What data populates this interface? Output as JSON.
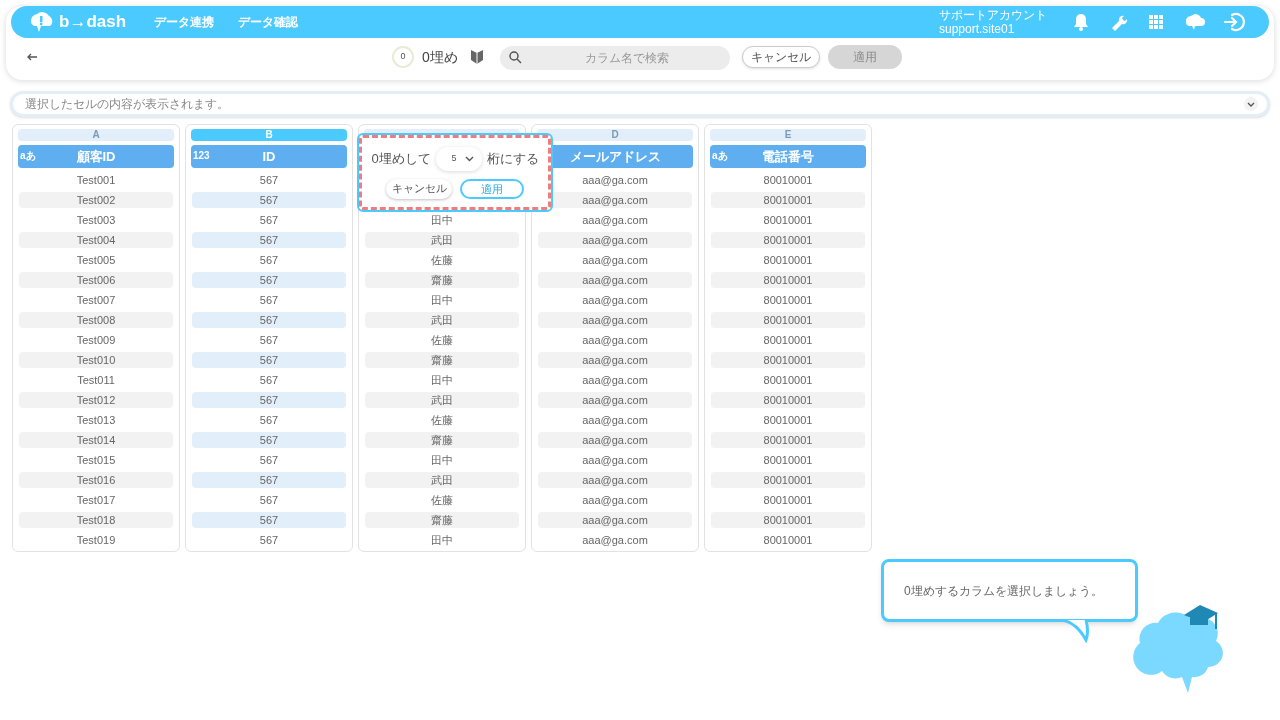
{
  "header": {
    "logo": "b→dash",
    "nav": [
      "データ連携",
      "データ確認"
    ],
    "account": {
      "name": "サポートアカウント",
      "id": "support.site01"
    }
  },
  "toolbar": {
    "feature_badge": "0",
    "feature_title": "0埋め",
    "search": {
      "placeholder": "カラム名で検索"
    },
    "cancel": "キャンセル",
    "apply": {
      "label": "適用",
      "disabled": true
    }
  },
  "cell_preview": {
    "placeholder": "選択したセルの内容が表示されます。"
  },
  "columns": [
    {
      "letter": "A",
      "title": "顧客ID",
      "type_label": "aあ",
      "selected": false,
      "cells": [
        "Test001",
        "Test002",
        "Test003",
        "Test004",
        "Test005",
        "Test006",
        "Test007",
        "Test008",
        "Test009",
        "Test010",
        "Test011",
        "Test012",
        "Test013",
        "Test014",
        "Test015",
        "Test016",
        "Test017",
        "Test018",
        "Test019"
      ]
    },
    {
      "letter": "B",
      "title": "ID",
      "type_label": "123",
      "selected": true,
      "cells": [
        "567",
        "567",
        "567",
        "567",
        "567",
        "567",
        "567",
        "567",
        "567",
        "567",
        "567",
        "567",
        "567",
        "567",
        "567",
        "567",
        "567",
        "567",
        "567"
      ]
    },
    {
      "selected": false,
      "cells": [
        "田中",
        "武田",
        "佐藤",
        "齋藤",
        "田中",
        "武田",
        "佐藤",
        "齋藤",
        "田中",
        "武田",
        "佐藤",
        "齋藤",
        "田中",
        "武田",
        "佐藤",
        "齋藤",
        "田中"
      ]
    },
    {
      "letter": "D",
      "title": "メールアドレス",
      "selected": false,
      "cells": [
        "aaa@ga.com",
        "aaa@ga.com",
        "aaa@ga.com",
        "aaa@ga.com",
        "aaa@ga.com",
        "aaa@ga.com",
        "aaa@ga.com",
        "aaa@ga.com",
        "aaa@ga.com",
        "aaa@ga.com",
        "aaa@ga.com",
        "aaa@ga.com",
        "aaa@ga.com",
        "aaa@ga.com",
        "aaa@ga.com",
        "aaa@ga.com",
        "aaa@ga.com",
        "aaa@ga.com",
        "aaa@ga.com"
      ]
    },
    {
      "letter": "E",
      "title": "電話番号",
      "type_label": "aあ",
      "selected": false,
      "cells": [
        "80010001",
        "80010001",
        "80010001",
        "80010001",
        "80010001",
        "80010001",
        "80010001",
        "80010001",
        "80010001",
        "80010001",
        "80010001",
        "80010001",
        "80010001",
        "80010001",
        "80010001",
        "80010001",
        "80010001",
        "80010001",
        "80010001"
      ]
    }
  ],
  "popover": {
    "prefix": "0埋めして",
    "digits": "5",
    "suffix": "桁にする",
    "cancel": "キャンセル",
    "apply": "適用"
  },
  "guide": {
    "message": "0埋めするカラムを選択しましょう。"
  }
}
